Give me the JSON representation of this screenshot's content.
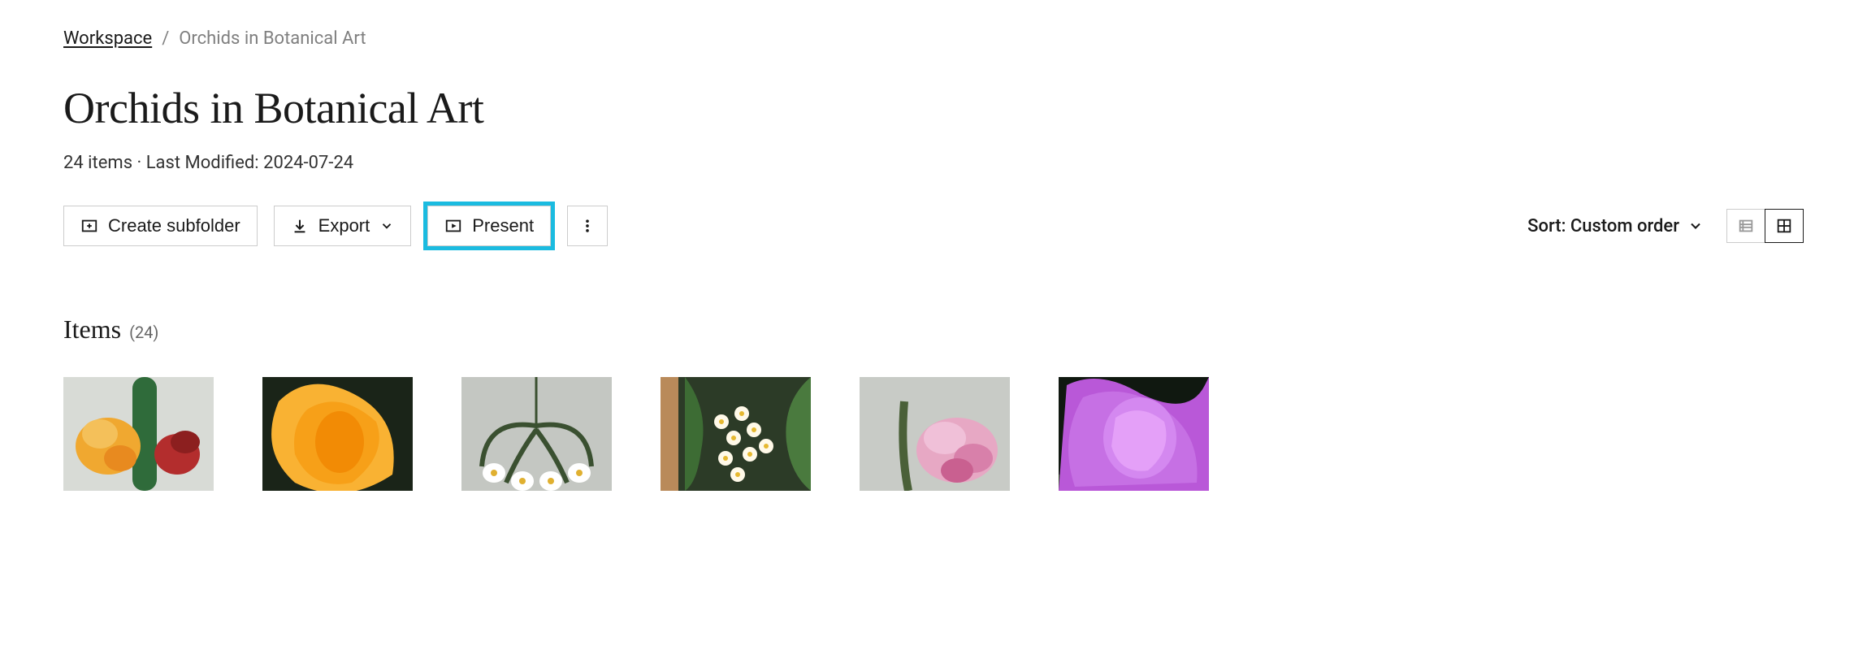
{
  "breadcrumb": {
    "root": "Workspace",
    "separator": "/",
    "current": "Orchids in Botanical Art"
  },
  "page": {
    "title": "Orchids in Botanical Art",
    "meta": "24 items · Last Modified: 2024-07-24"
  },
  "toolbar": {
    "create_subfolder_label": "Create subfolder",
    "export_label": "Export",
    "present_label": "Present",
    "sort_label": "Sort: Custom order"
  },
  "items_section": {
    "title": "Items",
    "count": "(24)"
  }
}
